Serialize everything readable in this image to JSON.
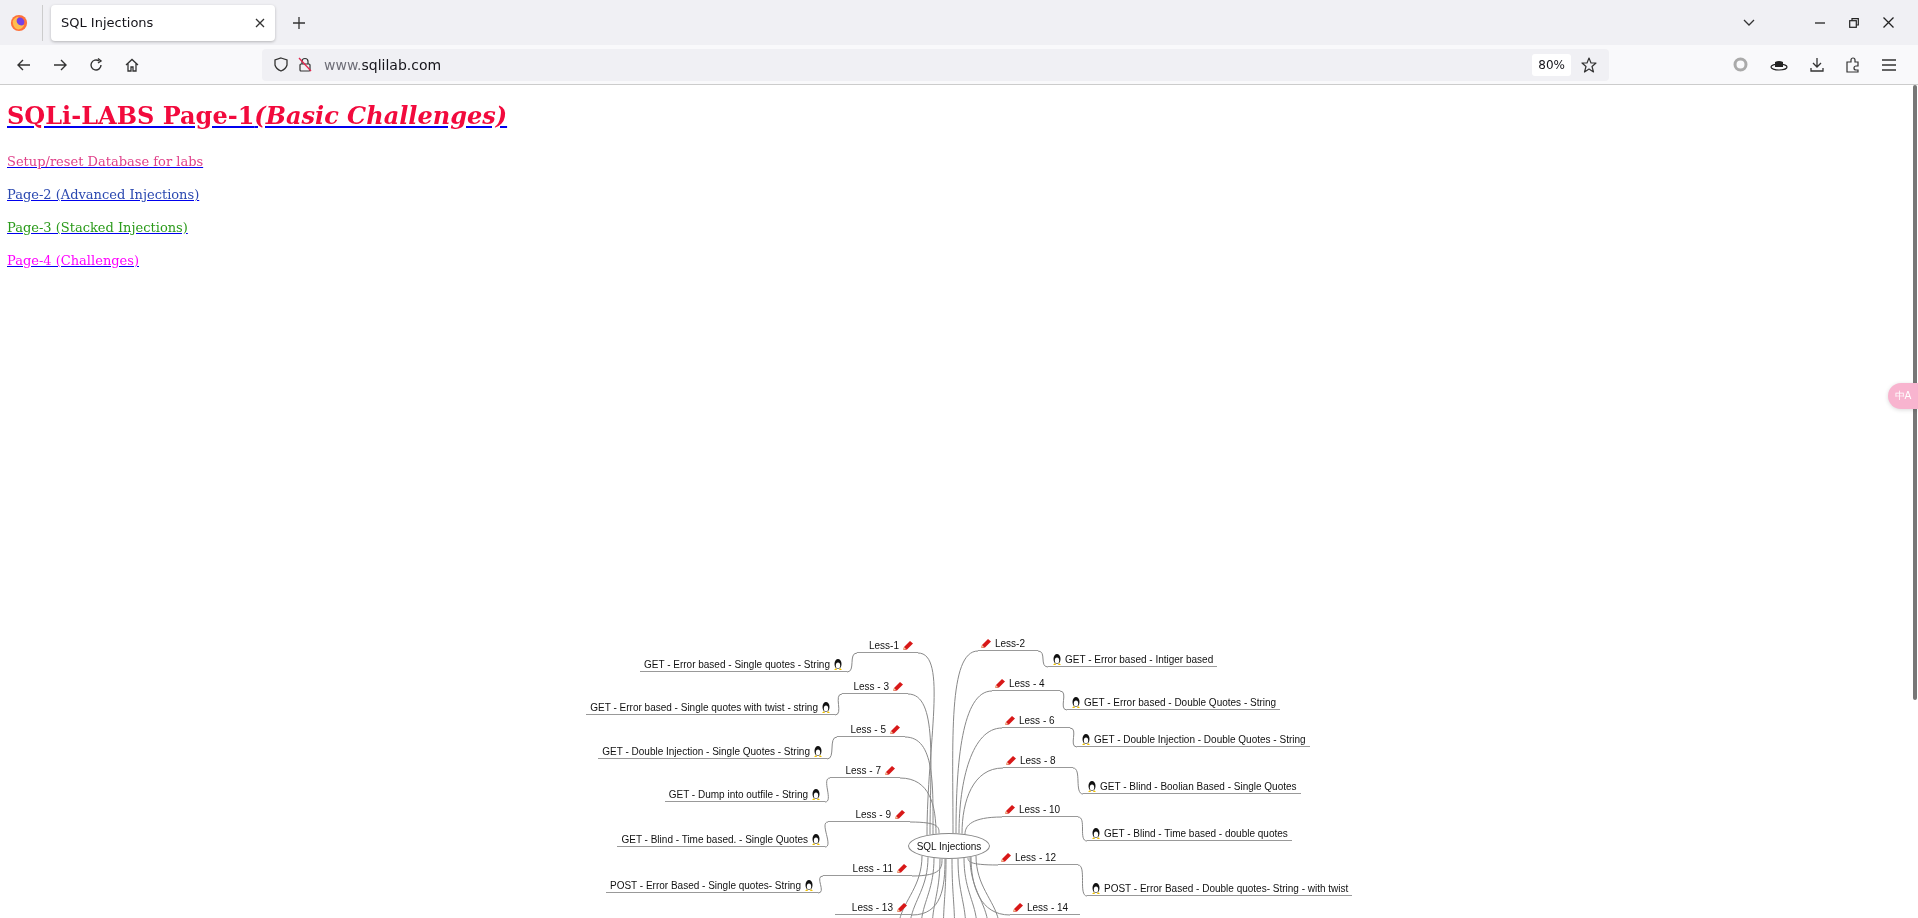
{
  "browser": {
    "tab": {
      "title": "SQL Injections",
      "selected": true
    },
    "address": {
      "subdomain": "www.",
      "domain": "sqlilab.com"
    },
    "zoom": "80%"
  },
  "page": {
    "heading": {
      "title": "SQLi-LABS Page-1",
      "subtitle": "(Basic Challenges)"
    },
    "links": [
      {
        "label": "Setup/reset Database for labs",
        "color": "#e0408a"
      },
      {
        "label": "Page-2 (Advanced Injections)",
        "color": "#2a48b0"
      },
      {
        "label": "Page-3 (Stacked Injections)",
        "color": "#2a9a1a"
      },
      {
        "label": "Page-4 (Challenges)",
        "color": "#ff00ff"
      }
    ]
  },
  "mind_map": {
    "center": "SQL Injections",
    "branches": [
      {
        "kind": "left",
        "label": "Less-1",
        "leaf": "GET - Error based - Single quotes - String"
      },
      {
        "kind": "right",
        "label": "Less-2",
        "leaf": "GET - Error based - Intiger based"
      },
      {
        "kind": "left",
        "label": "Less - 3",
        "leaf": "GET - Error based - Single quotes with twist - string"
      },
      {
        "kind": "right",
        "label": "Less - 4",
        "leaf": "GET - Error based - Double Quotes - String"
      },
      {
        "kind": "left",
        "label": "Less - 5",
        "leaf": "GET - Double Injection - Single Quotes - String"
      },
      {
        "kind": "right",
        "label": "Less - 6",
        "leaf": "GET - Double Injection - Double Quotes - String"
      },
      {
        "kind": "left",
        "label": "Less - 7",
        "leaf": "GET - Dump into outfile - String"
      },
      {
        "kind": "right",
        "label": "Less - 8",
        "leaf": "GET - Blind - Boolian Based - Single Quotes"
      },
      {
        "kind": "left",
        "label": "Less - 9",
        "leaf": "GET - Blind - Time based. -  Single Quotes"
      },
      {
        "kind": "right",
        "label": "Less - 10",
        "leaf": "GET - Blind - Time based - double quotes"
      },
      {
        "kind": "left",
        "label": "Less - 11",
        "leaf": "POST - Error Based - Single quotes- String"
      },
      {
        "kind": "right",
        "label": "Less - 12",
        "leaf": "POST - Error Based - Double quotes- String - with twist"
      },
      {
        "kind": "left",
        "label": "Less - 13"
      },
      {
        "kind": "right",
        "label": "Less - 14"
      }
    ]
  },
  "translate_widget": {
    "label": "中A"
  }
}
